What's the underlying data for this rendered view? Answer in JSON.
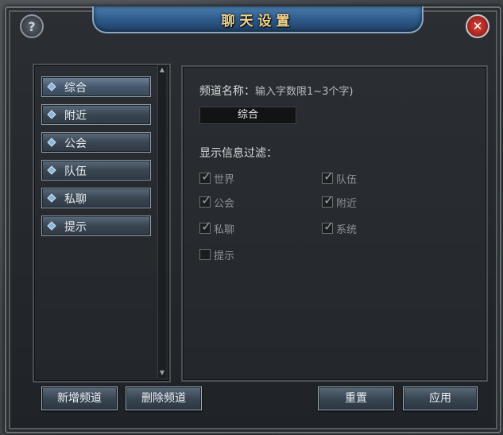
{
  "window": {
    "title": "聊天设置"
  },
  "icons": {
    "help": "?",
    "close": "✕",
    "check": "✓",
    "scroll_up": "▲",
    "scroll_down": "▼"
  },
  "channels": [
    {
      "label": "综合",
      "active": true
    },
    {
      "label": "附近",
      "active": false
    },
    {
      "label": "公会",
      "active": false
    },
    {
      "label": "队伍",
      "active": false
    },
    {
      "label": "私聊",
      "active": false
    },
    {
      "label": "提示",
      "active": false
    }
  ],
  "settings": {
    "name_label": "频道名称：",
    "name_hint": "输入字数限1~3个字)",
    "name_value": "综合",
    "filter_label": "显示信息过滤："
  },
  "filters": [
    {
      "label": "世界",
      "checked": true
    },
    {
      "label": "队伍",
      "checked": true
    },
    {
      "label": "公会",
      "checked": true
    },
    {
      "label": "附近",
      "checked": true
    },
    {
      "label": "私聊",
      "checked": true
    },
    {
      "label": "系统",
      "checked": true
    },
    {
      "label": "提示",
      "checked": false
    }
  ],
  "buttons": {
    "add_channel": "新增频道",
    "delete_channel": "删除频道",
    "reset": "重置",
    "apply": "应用"
  }
}
